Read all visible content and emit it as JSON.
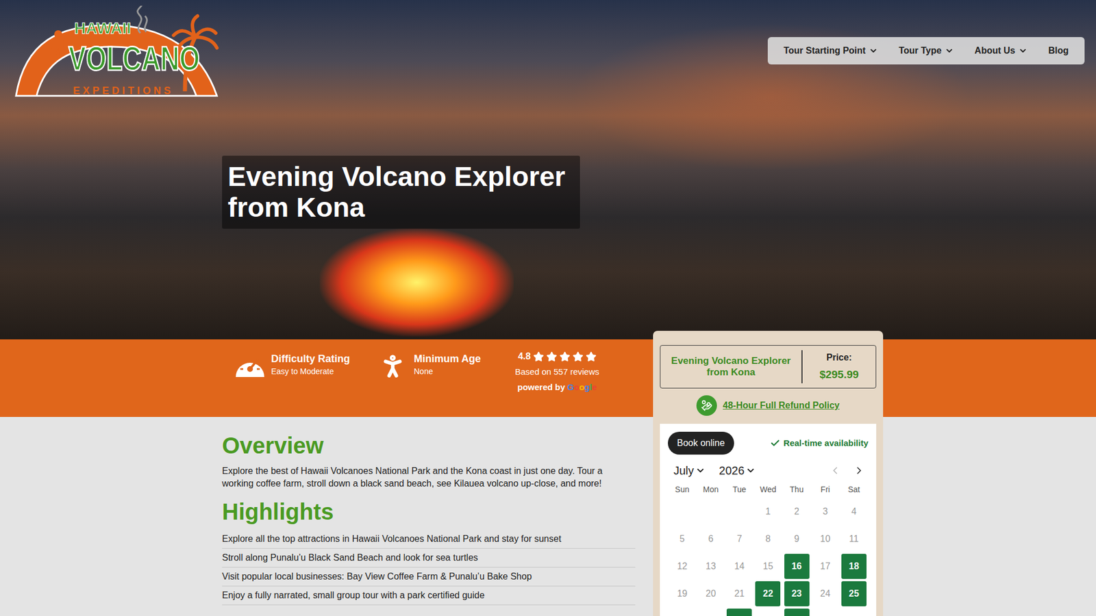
{
  "logo": {
    "top": "HAWAII",
    "main": "VOLCANO",
    "sub": "EXPEDITIONS"
  },
  "nav": [
    {
      "label": "Tour Starting Point",
      "dropdown": true
    },
    {
      "label": "Tour Type",
      "dropdown": true
    },
    {
      "label": "About Us",
      "dropdown": true
    },
    {
      "label": "Blog",
      "dropdown": false
    }
  ],
  "hero": {
    "title": "Evening Volcano Explorer from Kona"
  },
  "facts": [
    {
      "label": "Difficulty Rating",
      "value": "Easy to Moderate",
      "kind": "gauge"
    },
    {
      "label": "Minimum Age",
      "value": "None",
      "kind": "person"
    }
  ],
  "rating": {
    "score": "4.8",
    "stars": 5,
    "reviews": "Based on 557 reviews",
    "powered_by": "powered by",
    "provider": "Google"
  },
  "overview": {
    "heading": "Overview",
    "text": "Explore the best of Hawaii Volcanoes National Park and the Kona coast in just one day. Tour a working coffee farm, stroll down a black sand beach, see Kilauea volcano up-close, and more!"
  },
  "highlights": {
    "heading": "Highlights",
    "items": [
      "Explore all the top attractions in Hawaii Volcanoes National Park and stay for sunset",
      "Stroll along Punalu’u Black Sand Beach and look for sea turtles",
      "Visit popular local businesses: Bay View Coffee Farm & Punalu’u Bake Shop",
      "Enjoy a fully narrated, small group tour with a park certified guide"
    ]
  },
  "booking": {
    "title": "Evening Volcano Explorer from Kona",
    "price_label": "Price:",
    "price": "$295.99",
    "refund": "48-Hour Full Refund Policy",
    "tab": "Book online",
    "availability": "Real-time availability",
    "month": "July",
    "year": "2026",
    "weekdays": [
      "Sun",
      "Mon",
      "Tue",
      "Wed",
      "Thu",
      "Fri",
      "Sat"
    ],
    "weeks": [
      [
        null,
        null,
        null,
        {
          "day": "1",
          "available": false
        },
        {
          "day": "2",
          "available": false
        },
        {
          "day": "3",
          "available": false
        },
        {
          "day": "4",
          "available": false
        }
      ],
      [
        {
          "day": "5",
          "available": false
        },
        {
          "day": "6",
          "available": false
        },
        {
          "day": "7",
          "available": false
        },
        {
          "day": "8",
          "available": false
        },
        {
          "day": "9",
          "available": false
        },
        {
          "day": "10",
          "available": false
        },
        {
          "day": "11",
          "available": false
        }
      ],
      [
        {
          "day": "12",
          "available": false
        },
        {
          "day": "13",
          "available": false
        },
        {
          "day": "14",
          "available": false
        },
        {
          "day": "15",
          "available": false
        },
        {
          "day": "16",
          "available": true
        },
        {
          "day": "17",
          "available": false
        },
        {
          "day": "18",
          "available": true
        }
      ],
      [
        {
          "day": "19",
          "available": false
        },
        {
          "day": "20",
          "available": false
        },
        {
          "day": "21",
          "available": false
        },
        {
          "day": "22",
          "available": true
        },
        {
          "day": "23",
          "available": true
        },
        {
          "day": "24",
          "available": false
        },
        {
          "day": "25",
          "available": true
        }
      ]
    ],
    "next_week_available": [
      false,
      false,
      true,
      false,
      true,
      false,
      false
    ]
  }
}
